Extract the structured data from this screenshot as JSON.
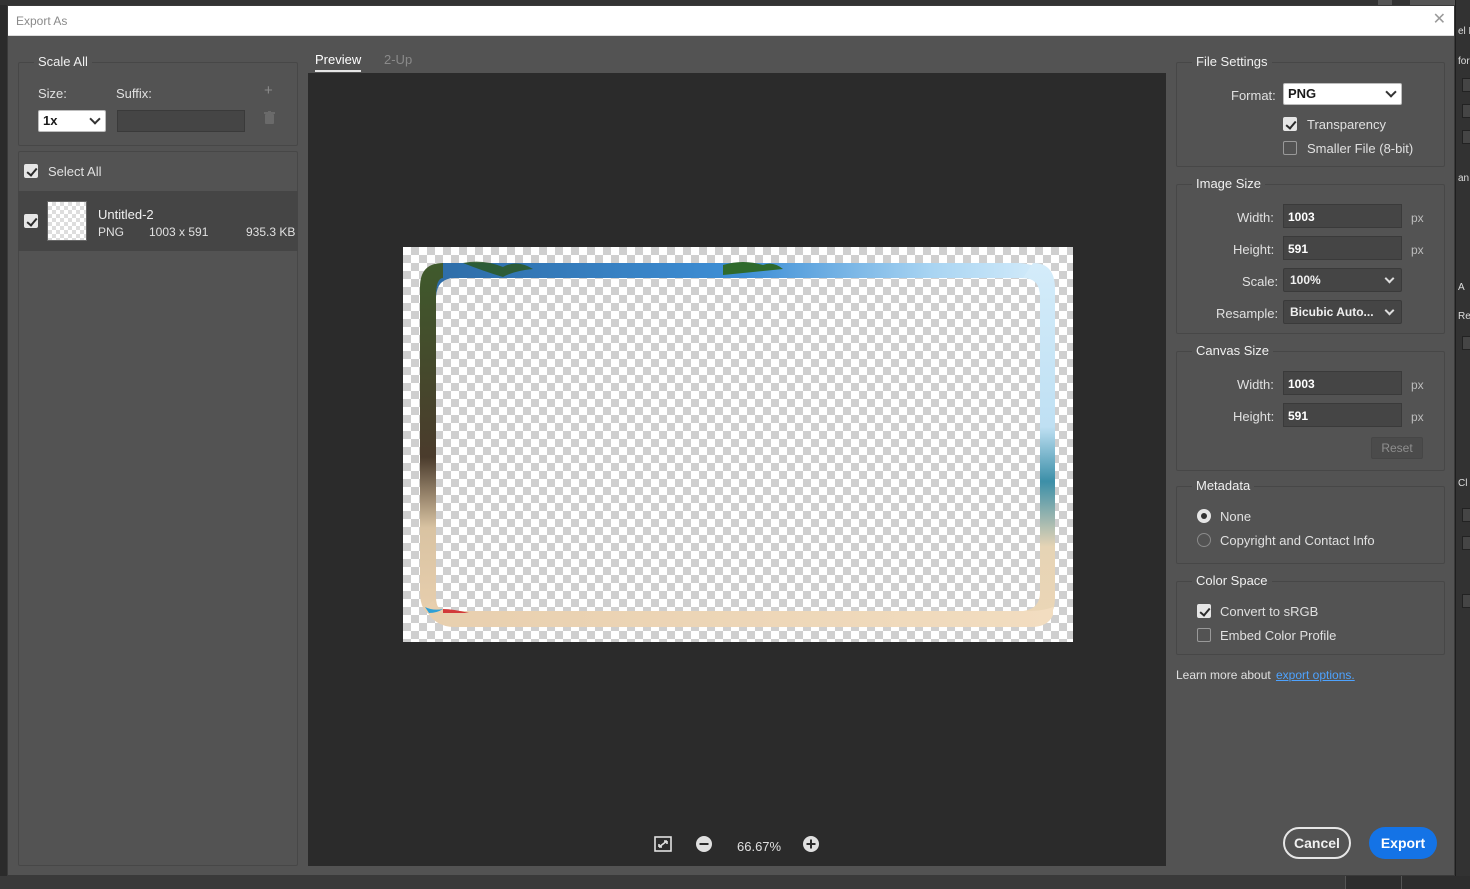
{
  "dialog": {
    "title": "Export As",
    "close_glyph": "✕"
  },
  "scale_all": {
    "title": "Scale All",
    "size_label": "Size:",
    "suffix_label": "Suffix:",
    "size_value": "1x",
    "suffix_value": "",
    "add_icon": "+",
    "delete_icon": "🗑"
  },
  "assets": {
    "select_all_label": "Select All",
    "items": [
      {
        "name": "Untitled-2",
        "format": "PNG",
        "dimensions": "1003 x 591",
        "size": "935.3 KB"
      }
    ]
  },
  "tabs": [
    {
      "label": "Preview"
    },
    {
      "label": "2-Up"
    }
  ],
  "zoom": {
    "level": "66.67%"
  },
  "file_settings": {
    "title": "File Settings",
    "format_label": "Format:",
    "format_value": "PNG",
    "transparency_label": "Transparency",
    "transparency_checked": true,
    "smaller_file_label": "Smaller File (8-bit)",
    "smaller_file_checked": false
  },
  "image_size": {
    "title": "Image Size",
    "width_label": "Width:",
    "width_value": "1003",
    "height_label": "Height:",
    "height_value": "591",
    "scale_label": "Scale:",
    "scale_value": "100%",
    "resample_label": "Resample:",
    "resample_value": "Bicubic Auto...",
    "unit": "px"
  },
  "canvas_size": {
    "title": "Canvas Size",
    "width_label": "Width:",
    "width_value": "1003",
    "height_label": "Height:",
    "height_value": "591",
    "unit": "px",
    "reset_label": "Reset"
  },
  "metadata": {
    "title": "Metadata",
    "options": [
      {
        "label": "None",
        "selected": true
      },
      {
        "label": "Copyright and Contact Info",
        "selected": false
      }
    ]
  },
  "color_space": {
    "title": "Color Space",
    "convert_label": "Convert to sRGB",
    "convert_checked": true,
    "embed_label": "Embed Color Profile",
    "embed_checked": false
  },
  "footer": {
    "learn_more_text": "Learn more about",
    "learn_more_link": "export options.",
    "cancel_label": "Cancel",
    "export_label": "Export"
  },
  "background_fragments": [
    "el L",
    "for",
    "an",
    "A",
    "Re",
    "Cl"
  ],
  "colors": {
    "accent": "#1473e6",
    "link": "#4ea3ff",
    "panel": "#535353",
    "preview_bg": "#2b2b2b"
  }
}
